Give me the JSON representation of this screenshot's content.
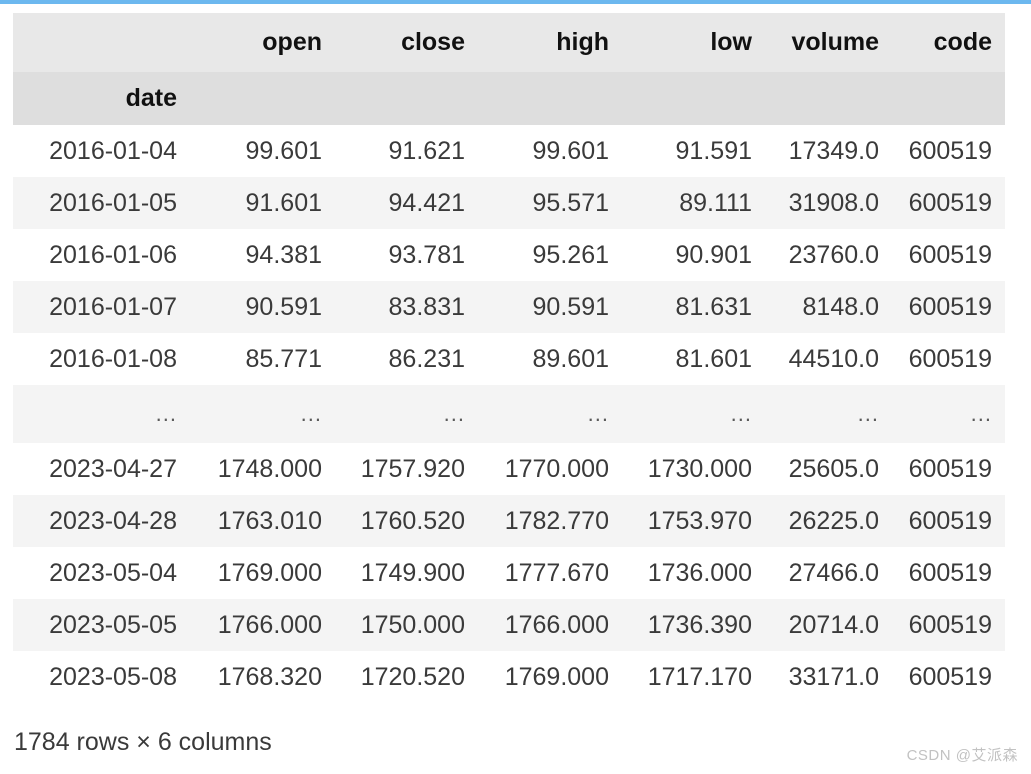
{
  "table": {
    "index_name": "date",
    "columns": [
      "open",
      "close",
      "high",
      "low",
      "volume",
      "code"
    ],
    "ellipsis": "...",
    "rows": [
      {
        "index": "2016-01-04",
        "cells": [
          "99.601",
          "91.621",
          "99.601",
          "91.591",
          "17349.0",
          "600519"
        ]
      },
      {
        "index": "2016-01-05",
        "cells": [
          "91.601",
          "94.421",
          "95.571",
          "89.111",
          "31908.0",
          "600519"
        ]
      },
      {
        "index": "2016-01-06",
        "cells": [
          "94.381",
          "93.781",
          "95.261",
          "90.901",
          "23760.0",
          "600519"
        ]
      },
      {
        "index": "2016-01-07",
        "cells": [
          "90.591",
          "83.831",
          "90.591",
          "81.631",
          "8148.0",
          "600519"
        ]
      },
      {
        "index": "2016-01-08",
        "cells": [
          "85.771",
          "86.231",
          "89.601",
          "81.601",
          "44510.0",
          "600519"
        ]
      },
      {
        "index": "...",
        "cells": [
          "...",
          "...",
          "...",
          "...",
          "...",
          "..."
        ]
      },
      {
        "index": "2023-04-27",
        "cells": [
          "1748.000",
          "1757.920",
          "1770.000",
          "1730.000",
          "25605.0",
          "600519"
        ]
      },
      {
        "index": "2023-04-28",
        "cells": [
          "1763.010",
          "1760.520",
          "1782.770",
          "1753.970",
          "26225.0",
          "600519"
        ]
      },
      {
        "index": "2023-05-04",
        "cells": [
          "1769.000",
          "1749.900",
          "1777.670",
          "1736.000",
          "27466.0",
          "600519"
        ]
      },
      {
        "index": "2023-05-05",
        "cells": [
          "1766.000",
          "1750.000",
          "1766.000",
          "1736.390",
          "20714.0",
          "600519"
        ]
      },
      {
        "index": "2023-05-08",
        "cells": [
          "1768.320",
          "1720.520",
          "1769.000",
          "1717.170",
          "33171.0",
          "600519"
        ]
      }
    ]
  },
  "shape_caption": "1784 rows × 6 columns",
  "watermark": "CSDN @艾派森",
  "colors": {
    "top_rule": "#6cb8ef",
    "header_bg": "#e8e8e8",
    "index_name_bg": "#dedede",
    "stripe_bg": "#f4f4f4",
    "text": "#3a3a3a",
    "header_text": "#111111",
    "watermark_text": "#c2c2c2"
  }
}
